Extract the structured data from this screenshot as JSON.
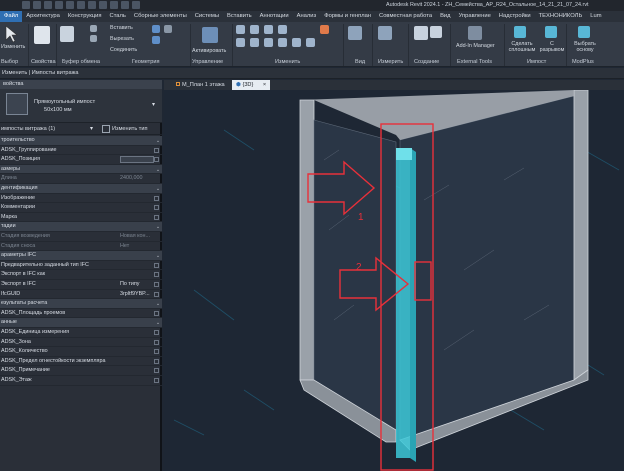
{
  "window_title": "Autodesk Revit 2024.1 - ZH_Семейства_AP_R24_Остальное_14_21_21_07_24.rvt",
  "menu_tabs": [
    "Файл",
    "Архитектура",
    "Конструкция",
    "Сталь",
    "Сборные элементы",
    "Системы",
    "Вставить",
    "Аннотации",
    "Анализ",
    "Формы и генплан",
    "Совместная работа",
    "Вид",
    "Управление",
    "Надстройки",
    "ТЕХНОНИКОЛЬ",
    "Lum"
  ],
  "ribbon": {
    "select_label": "Выбор",
    "modify_label": "Изменить",
    "properties_label": "Свойства",
    "clipboard_label": "Буфер обмена",
    "insert_label": "Вставить",
    "cut_label": "Вырезать",
    "join_label": "Соединить",
    "geometry_label": "Геометрия",
    "activate_label": "Активировать",
    "management_label": "Управление",
    "modify_group_label": "Изменить",
    "view_label": "Вид",
    "measure_label": "Измерить",
    "create_label": "Создание",
    "addin_manager_label": "Add-In Manager",
    "external_tools_label": "External Tools",
    "make_solid_label": "Сделать сплошным",
    "with_gap_label": "С разрывом",
    "choose_base_label": "Выбрать основу",
    "mullion_group_label": "Импост",
    "modplus_label": "ModPlus"
  },
  "option_bar": "Изменить | Импосты витража",
  "properties": {
    "header": "войства",
    "type_name": "Прямоугольный импост",
    "type_size": "50x100 мм",
    "instance_filter": "импосты витража (1)",
    "edit_type": "Изменить тип",
    "rows": [
      {
        "k": "троительство",
        "sec": true
      },
      {
        "k": "ADSK_Группирование",
        "v": ""
      },
      {
        "k": "ADSK_Позиция",
        "v": "",
        "box": true
      },
      {
        "k": "азмеры",
        "sec": true
      },
      {
        "k": "Длина",
        "v": "2400,000",
        "dim": true
      },
      {
        "k": "дентификация",
        "sec": true
      },
      {
        "k": "Изображение",
        "v": ""
      },
      {
        "k": "Комментарии",
        "v": ""
      },
      {
        "k": "Марка",
        "v": ""
      },
      {
        "k": "тадии",
        "sec": true
      },
      {
        "k": "Стадия возведения",
        "v": "Новая кон...",
        "dim": true
      },
      {
        "k": "Стадия сноса",
        "v": "Нет",
        "dim": true
      },
      {
        "k": "араметры IFC",
        "sec": true
      },
      {
        "k": "Предварительно заданный тип IFC",
        "v": ""
      },
      {
        "k": "Экспорт в IFC как",
        "v": ""
      },
      {
        "k": "Экспорт в IFC",
        "v": "По типу"
      },
      {
        "k": "IfcGUID",
        "v": "3rpltf9YBP..."
      },
      {
        "k": "езультаты расчета",
        "sec": true
      },
      {
        "k": "ADSK_Площадь проемов",
        "v": ""
      },
      {
        "k": "анные",
        "sec": true
      },
      {
        "k": "ADSK_Единица измерения",
        "v": ""
      },
      {
        "k": "ADSK_Зона",
        "v": ""
      },
      {
        "k": "ADSK_Количество",
        "v": ""
      },
      {
        "k": "ADSK_Предел огнестойкости экземпляра",
        "v": ""
      },
      {
        "k": "ADSK_Примечание",
        "v": ""
      },
      {
        "k": "ADSK_Этаж",
        "v": ""
      }
    ]
  },
  "view_tabs": [
    "M_План 1 этажа",
    "{3D}"
  ],
  "annotations": {
    "label1": "1",
    "label2": "2"
  },
  "colors": {
    "accent": "#2f6fb3",
    "highlight": "#e8303a",
    "glass": "#3cc8d8"
  }
}
